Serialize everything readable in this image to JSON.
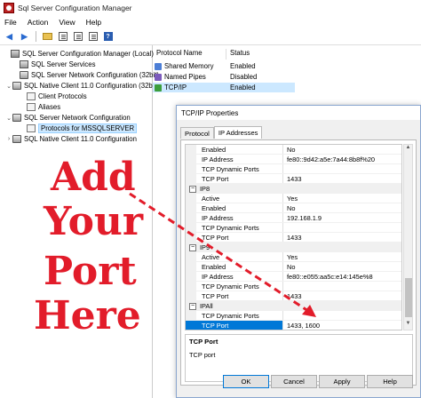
{
  "window": {
    "title": "Sql Server Configuration Manager"
  },
  "menu": [
    "File",
    "Action",
    "View",
    "Help"
  ],
  "toolbar": [
    "back-arrow",
    "forward-arrow",
    "folder-up",
    "show-hide-console-tree",
    "export-list",
    "properties",
    "help"
  ],
  "tree": {
    "items": [
      {
        "label": "SQL Server Configuration Manager (Local)",
        "level": 0,
        "expander": "",
        "icon": "server"
      },
      {
        "label": "SQL Server Services",
        "level": 1,
        "expander": "",
        "icon": "services"
      },
      {
        "label": "SQL Server Network Configuration (32bit)",
        "level": 1,
        "expander": "",
        "icon": "network"
      },
      {
        "label": "SQL Native Client 11.0 Configuration (32b",
        "level": 1,
        "expander": "⌄",
        "icon": "network"
      },
      {
        "label": "Client Protocols",
        "level": 2,
        "expander": "",
        "icon": "proto"
      },
      {
        "label": "Aliases",
        "level": 2,
        "expander": "",
        "icon": "alias"
      },
      {
        "label": "SQL Server Network Configuration",
        "level": 1,
        "expander": "⌄",
        "icon": "network"
      },
      {
        "label": "Protocols for MSSQLSERVER",
        "level": 2,
        "expander": "",
        "icon": "proto",
        "selected": true
      },
      {
        "label": "SQL Native Client 11.0 Configuration",
        "level": 1,
        "expander": "›",
        "icon": "network"
      }
    ]
  },
  "list": {
    "headers": [
      "Protocol Name",
      "Status"
    ],
    "rows": [
      {
        "name": "Shared Memory",
        "status": "Enabled",
        "icon": "shm"
      },
      {
        "name": "Named Pipes",
        "status": "Disabled",
        "icon": "pipe"
      },
      {
        "name": "TCP/IP",
        "status": "Enabled",
        "icon": "tcp",
        "selected": true
      }
    ]
  },
  "annotation": {
    "line1": "Add",
    "line2": "Your",
    "line3": "Port",
    "line4": "Here"
  },
  "dialog": {
    "title": "TCP/IP Properties",
    "tabs": [
      "Protocol",
      "IP Addresses"
    ],
    "grid": {
      "rows": [
        {
          "type": "prop",
          "key": "Enabled",
          "value": "No"
        },
        {
          "type": "prop",
          "key": "IP Address",
          "value": "fe80::9d42:a5e:7a44:8b8f%20"
        },
        {
          "type": "prop",
          "key": "TCP Dynamic Ports",
          "value": ""
        },
        {
          "type": "prop",
          "key": "TCP Port",
          "value": "1433"
        },
        {
          "type": "cat",
          "key": "IP8"
        },
        {
          "type": "prop",
          "key": "Active",
          "value": "Yes"
        },
        {
          "type": "prop",
          "key": "Enabled",
          "value": "No"
        },
        {
          "type": "prop",
          "key": "IP Address",
          "value": "192.168.1.9"
        },
        {
          "type": "prop",
          "key": "TCP Dynamic Ports",
          "value": ""
        },
        {
          "type": "prop",
          "key": "TCP Port",
          "value": "1433"
        },
        {
          "type": "cat",
          "key": "IP9"
        },
        {
          "type": "prop",
          "key": "Active",
          "value": "Yes"
        },
        {
          "type": "prop",
          "key": "Enabled",
          "value": "No"
        },
        {
          "type": "prop",
          "key": "IP Address",
          "value": "fe80::e055:aa5c:e14:145e%8"
        },
        {
          "type": "prop",
          "key": "TCP Dynamic Ports",
          "value": ""
        },
        {
          "type": "prop",
          "key": "TCP Port",
          "value": "1433"
        },
        {
          "type": "cat",
          "key": "IPAll"
        },
        {
          "type": "prop",
          "key": "TCP Dynamic Ports",
          "value": ""
        },
        {
          "type": "prop",
          "key": "TCP Port",
          "value": "1433, 1600",
          "highlight": true
        }
      ]
    },
    "description": {
      "title": "TCP Port",
      "text": "TCP port"
    },
    "buttons": {
      "ok": "OK",
      "cancel": "Cancel",
      "apply": "Apply",
      "help": "Help"
    }
  },
  "colors": {
    "annotation_red": "#e21c2a",
    "selection_blue": "#0078d7",
    "tree_selection": "#cce8ff"
  }
}
